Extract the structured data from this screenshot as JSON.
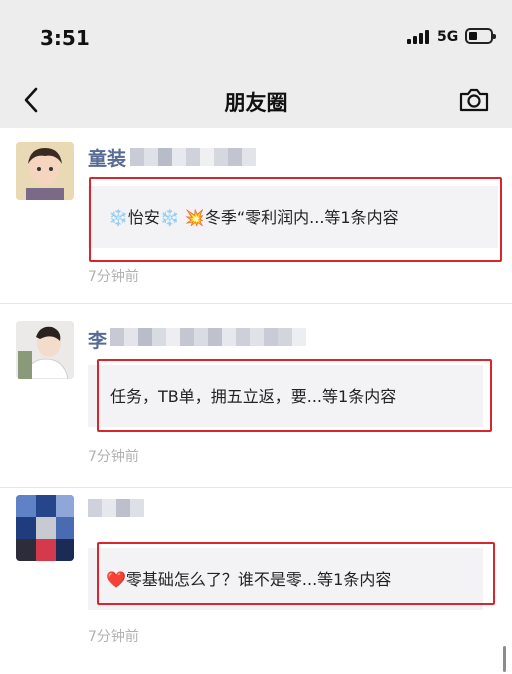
{
  "status_bar": {
    "time": "3:51",
    "network": "5G"
  },
  "nav": {
    "title": "朋友圈"
  },
  "posts": [
    {
      "name": "童装",
      "card_text": "❄️怡安❄️ 💥冬季“零利润内...等1条内容",
      "time": "7分钟前"
    },
    {
      "name": "李",
      "card_text": "任务，TB单，拥五立返，要...等1条内容",
      "time": "7分钟前"
    },
    {
      "name": "",
      "card_text": "❤️零基础怎么了？谁不是零...等1条内容",
      "time": "7分钟前"
    }
  ],
  "icons": {
    "back": "chevron-left-icon",
    "camera": "camera-icon"
  },
  "colors": {
    "username": "#576b95",
    "highlight_box": "#d9262c",
    "time": "#b2b2b2",
    "background": "#ededed"
  }
}
